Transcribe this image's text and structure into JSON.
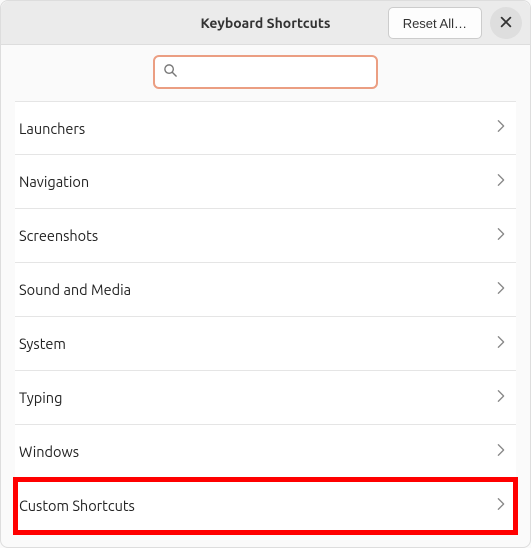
{
  "header": {
    "title": "Keyboard Shortcuts",
    "reset_label": "Reset All…"
  },
  "search": {
    "value": "",
    "placeholder": ""
  },
  "categories": [
    {
      "label": "Launchers"
    },
    {
      "label": "Navigation"
    },
    {
      "label": "Screenshots"
    },
    {
      "label": "Sound and Media"
    },
    {
      "label": "System"
    },
    {
      "label": "Typing"
    },
    {
      "label": "Windows"
    },
    {
      "label": "Custom Shortcuts",
      "highlighted": true
    }
  ]
}
